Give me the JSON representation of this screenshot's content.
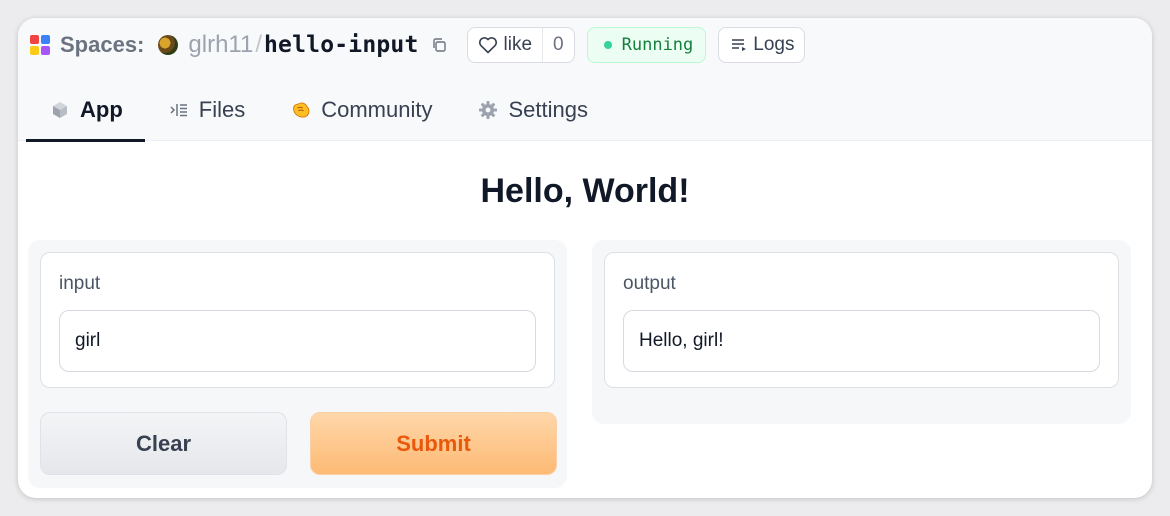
{
  "header": {
    "spaces_label": "Spaces:",
    "owner": "glrh11",
    "separator": "/",
    "repo": "hello-input",
    "like_label": "like",
    "like_count": "0",
    "status": "Running",
    "logs_label": "Logs",
    "logo_colors": [
      "#ef4444",
      "#3b82f6",
      "#facc15",
      "#a855f7"
    ]
  },
  "tabs": [
    {
      "label": "App",
      "icon": "cube-icon",
      "active": true
    },
    {
      "label": "Files",
      "icon": "files-icon",
      "active": false
    },
    {
      "label": "Community",
      "icon": "clap-icon",
      "active": false
    },
    {
      "label": "Settings",
      "icon": "gear-icon",
      "active": false
    }
  ],
  "app": {
    "title": "Hello, World!",
    "input": {
      "label": "input",
      "value": "girl"
    },
    "output": {
      "label": "output",
      "value": "Hello, girl!"
    },
    "clear_label": "Clear",
    "submit_label": "Submit"
  },
  "colors": {
    "status_green": "#15803d",
    "submit_text": "#ea580c",
    "submit_bg": "#fdba74"
  }
}
